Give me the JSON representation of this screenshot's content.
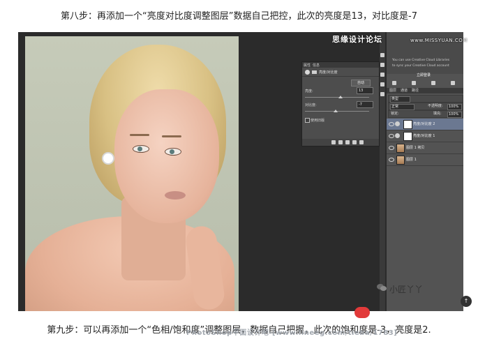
{
  "captions": {
    "top": "第八步：再添加一个“亮度对比度调整图层”数据自己把控，此次的亮度是13，对比度是-7",
    "bottom": "第九步：可以再添加一个“色相/饱和度”调整图层，数据自己把握，此次的饱和度是-3，亮度是2."
  },
  "watermarks": {
    "site_cn": "思缘设计论坛",
    "site_en": "www.MISSYUAN.COM",
    "wechat": "小匠丫丫",
    "bottom": "PhotoShop平面设计吧-[www.lineeg.com/tieba/1783]"
  },
  "properties_panel": {
    "tabs": [
      "属性",
      "信息"
    ],
    "header": "亮度/对比度",
    "auto_label": "自动",
    "brightness_label": "亮度:",
    "brightness_value": "13",
    "contrast_label": "对比度:",
    "contrast_value": "-7",
    "legacy_label": "使用旧版"
  },
  "libraries": {
    "line1": "You can use Creative Cloud Libraries",
    "line2": "to sync your Creative Cloud account",
    "login": "立即登录"
  },
  "layers_panel": {
    "tabs": [
      "图层",
      "通道",
      "路径"
    ],
    "kind": "类型",
    "blend_mode": "正常",
    "opacity_label": "不透明度:",
    "opacity_value": "100%",
    "lock_label": "锁定:",
    "fill_label": "填充:",
    "fill_value": "100%",
    "layers": [
      {
        "name": "亮度/对比度 2",
        "type": "adjustment",
        "selected": true
      },
      {
        "name": "亮度/对比度 1",
        "type": "adjustment",
        "selected": false
      },
      {
        "name": "图层 1 拷贝",
        "type": "image",
        "selected": false
      },
      {
        "name": "图层 1",
        "type": "image",
        "selected": false
      }
    ]
  },
  "colors": {
    "panel_bg": "#535353",
    "selected_layer": "#6b7891",
    "canvas_bg": "#2b2b2b"
  }
}
